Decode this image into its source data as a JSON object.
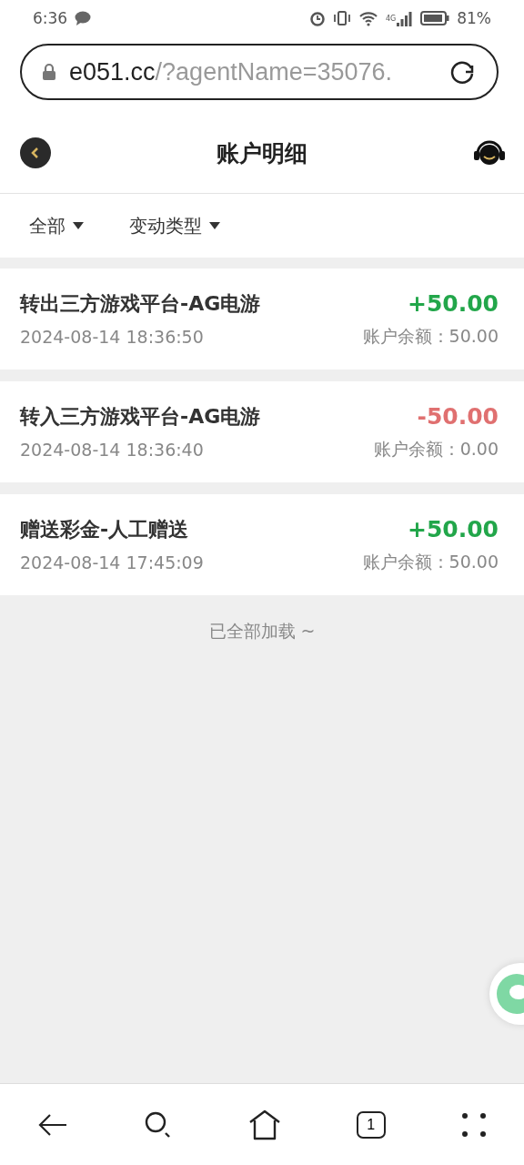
{
  "status_bar": {
    "time": "6:36",
    "battery": "81%",
    "network": "4G"
  },
  "address_bar": {
    "host": "e051.cc",
    "path": "/?agentName=35076."
  },
  "header": {
    "title": "账户明细"
  },
  "filters": [
    {
      "label": "全部"
    },
    {
      "label": "变动类型"
    }
  ],
  "transactions": [
    {
      "title": "转出三方游戏平台-AG电游",
      "time": "2024-08-14 18:36:50",
      "amount": "+50.00",
      "credit": true,
      "balance": "账户余额：50.00"
    },
    {
      "title": "转入三方游戏平台-AG电游",
      "time": "2024-08-14 18:36:40",
      "amount": "-50.00",
      "credit": false,
      "balance": "账户余额：0.00"
    },
    {
      "title": "赠送彩金-人工赠送",
      "time": "2024-08-14 17:45:09",
      "amount": "+50.00",
      "credit": true,
      "balance": "账户余额：50.00"
    }
  ],
  "end_note": "已全部加载 ~",
  "bottom_nav": {
    "tab_count": "1"
  }
}
